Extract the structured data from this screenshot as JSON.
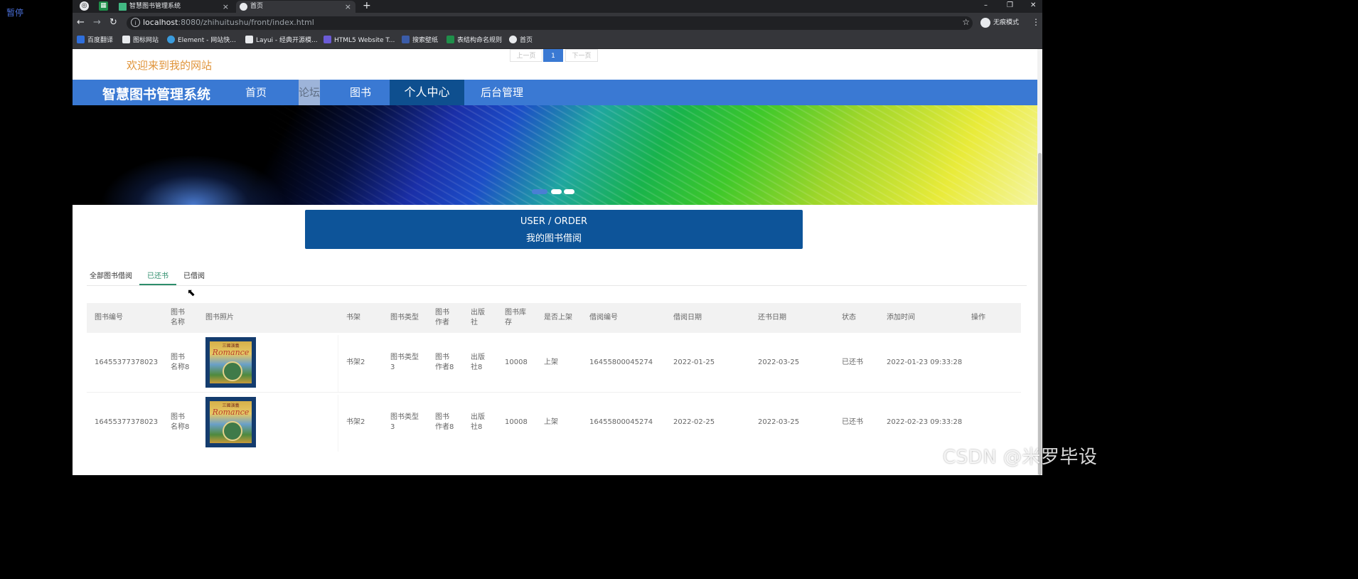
{
  "overlay": {
    "pause_label": "暂停"
  },
  "browser": {
    "tabs": [
      {
        "label": "智慧图书管理系统",
        "close": "×"
      },
      {
        "label": "首页",
        "close": "×"
      }
    ],
    "new_tab": "+",
    "window_controls": {
      "minimize": "–",
      "restore": "❐",
      "close": "✕"
    },
    "nav": {
      "back": "←",
      "forward": "→",
      "reload": "↻"
    },
    "url_host": "localhost",
    "url_path": ":8080/zhihuitushu/front/index.html",
    "star": "☆",
    "incognito_label": "无痕模式",
    "more": "⋮",
    "bookmarks": [
      {
        "label": "百度翻译",
        "color": "#2f6fdc"
      },
      {
        "label": "图标网站",
        "color": "#e8eaed"
      },
      {
        "label": "Element - 网站快...",
        "color": "#3a9bdc"
      },
      {
        "label": "Layui - 经典开源模...",
        "color": "#e8eaed"
      },
      {
        "label": "HTML5 Website T...",
        "color": "#6b5bd6"
      },
      {
        "label": "搜索壁纸",
        "color": "#3b5ca8"
      },
      {
        "label": "表结构命名规则",
        "color": "#1f8f4a"
      },
      {
        "label": "首页",
        "color": "#e8eaed"
      }
    ]
  },
  "site": {
    "welcome": "欢迎来到我的网站",
    "brand": "智慧图书管理系统",
    "nav": [
      "首页",
      "论坛",
      "图书",
      "个人中心",
      "后台管理"
    ],
    "active_nav": "个人中心",
    "carousel_active": 1,
    "section_title_en": "USER / ORDER",
    "section_title_cn": "我的图书借阅"
  },
  "subtabs": [
    "全部图书借阅",
    "已还书",
    "已借阅"
  ],
  "active_subtab": "已还书",
  "table": {
    "headers": [
      "图书编号",
      "图书\n名称",
      "图书照片",
      "书架",
      "图书类型",
      "图书\n作者",
      "出版\n社",
      "图书库\n存",
      "是否上架",
      "借阅编号",
      "借阅日期",
      "还书日期",
      "状态",
      "添加时间",
      "操作"
    ],
    "cover": {
      "kicker": "三國演義",
      "title": "Romance"
    },
    "rows": [
      {
        "id": "16455377378023",
        "name": "图书\n名称8",
        "shelf": "书架2",
        "type": "图书类型\n3",
        "author": "图书\n作者8",
        "publisher": "出版\n社8",
        "stock": "10008",
        "listed": "上架",
        "borrow_no": "16455800045274",
        "borrow_date": "2022-01-25",
        "return_date": "2022-03-25",
        "status": "已还书",
        "added": "2022-01-23 09:33:28",
        "action": ""
      },
      {
        "id": "16455377378023",
        "name": "图书\n名称8",
        "shelf": "书架2",
        "type": "图书类型\n3",
        "author": "图书\n作者8",
        "publisher": "出版\n社8",
        "stock": "10008",
        "listed": "上架",
        "borrow_no": "16455800045274",
        "borrow_date": "2022-02-25",
        "return_date": "2022-03-25",
        "status": "已还书",
        "added": "2022-02-23 09:33:28",
        "action": ""
      }
    ]
  },
  "pagination": {
    "prev": "上一页",
    "current": "1",
    "next": "下一页"
  },
  "watermark": "CSDN @米罗毕设"
}
